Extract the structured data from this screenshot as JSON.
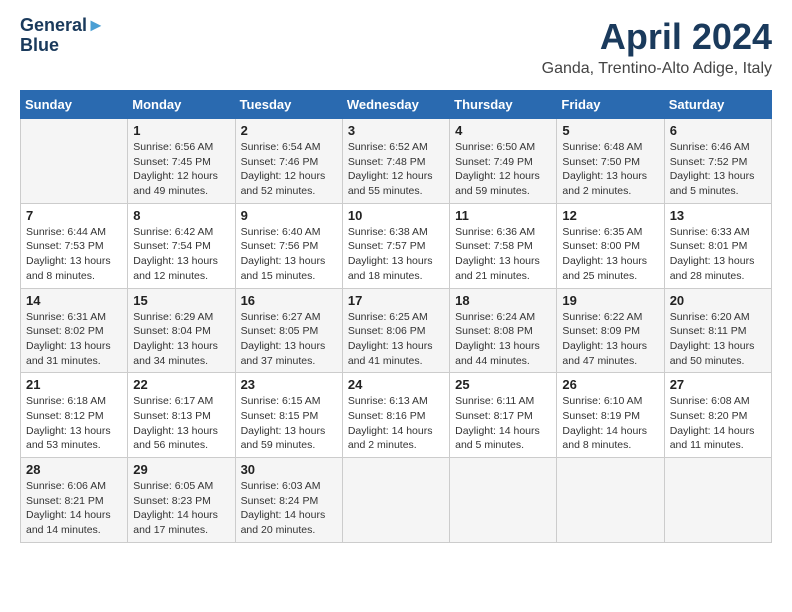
{
  "header": {
    "logo_line1": "General",
    "logo_line2": "Blue",
    "month": "April 2024",
    "location": "Ganda, Trentino-Alto Adige, Italy"
  },
  "weekdays": [
    "Sunday",
    "Monday",
    "Tuesday",
    "Wednesday",
    "Thursday",
    "Friday",
    "Saturday"
  ],
  "weeks": [
    [
      {
        "day": "",
        "info": ""
      },
      {
        "day": "1",
        "info": "Sunrise: 6:56 AM\nSunset: 7:45 PM\nDaylight: 12 hours\nand 49 minutes."
      },
      {
        "day": "2",
        "info": "Sunrise: 6:54 AM\nSunset: 7:46 PM\nDaylight: 12 hours\nand 52 minutes."
      },
      {
        "day": "3",
        "info": "Sunrise: 6:52 AM\nSunset: 7:48 PM\nDaylight: 12 hours\nand 55 minutes."
      },
      {
        "day": "4",
        "info": "Sunrise: 6:50 AM\nSunset: 7:49 PM\nDaylight: 12 hours\nand 59 minutes."
      },
      {
        "day": "5",
        "info": "Sunrise: 6:48 AM\nSunset: 7:50 PM\nDaylight: 13 hours\nand 2 minutes."
      },
      {
        "day": "6",
        "info": "Sunrise: 6:46 AM\nSunset: 7:52 PM\nDaylight: 13 hours\nand 5 minutes."
      }
    ],
    [
      {
        "day": "7",
        "info": "Sunrise: 6:44 AM\nSunset: 7:53 PM\nDaylight: 13 hours\nand 8 minutes."
      },
      {
        "day": "8",
        "info": "Sunrise: 6:42 AM\nSunset: 7:54 PM\nDaylight: 13 hours\nand 12 minutes."
      },
      {
        "day": "9",
        "info": "Sunrise: 6:40 AM\nSunset: 7:56 PM\nDaylight: 13 hours\nand 15 minutes."
      },
      {
        "day": "10",
        "info": "Sunrise: 6:38 AM\nSunset: 7:57 PM\nDaylight: 13 hours\nand 18 minutes."
      },
      {
        "day": "11",
        "info": "Sunrise: 6:36 AM\nSunset: 7:58 PM\nDaylight: 13 hours\nand 21 minutes."
      },
      {
        "day": "12",
        "info": "Sunrise: 6:35 AM\nSunset: 8:00 PM\nDaylight: 13 hours\nand 25 minutes."
      },
      {
        "day": "13",
        "info": "Sunrise: 6:33 AM\nSunset: 8:01 PM\nDaylight: 13 hours\nand 28 minutes."
      }
    ],
    [
      {
        "day": "14",
        "info": "Sunrise: 6:31 AM\nSunset: 8:02 PM\nDaylight: 13 hours\nand 31 minutes."
      },
      {
        "day": "15",
        "info": "Sunrise: 6:29 AM\nSunset: 8:04 PM\nDaylight: 13 hours\nand 34 minutes."
      },
      {
        "day": "16",
        "info": "Sunrise: 6:27 AM\nSunset: 8:05 PM\nDaylight: 13 hours\nand 37 minutes."
      },
      {
        "day": "17",
        "info": "Sunrise: 6:25 AM\nSunset: 8:06 PM\nDaylight: 13 hours\nand 41 minutes."
      },
      {
        "day": "18",
        "info": "Sunrise: 6:24 AM\nSunset: 8:08 PM\nDaylight: 13 hours\nand 44 minutes."
      },
      {
        "day": "19",
        "info": "Sunrise: 6:22 AM\nSunset: 8:09 PM\nDaylight: 13 hours\nand 47 minutes."
      },
      {
        "day": "20",
        "info": "Sunrise: 6:20 AM\nSunset: 8:11 PM\nDaylight: 13 hours\nand 50 minutes."
      }
    ],
    [
      {
        "day": "21",
        "info": "Sunrise: 6:18 AM\nSunset: 8:12 PM\nDaylight: 13 hours\nand 53 minutes."
      },
      {
        "day": "22",
        "info": "Sunrise: 6:17 AM\nSunset: 8:13 PM\nDaylight: 13 hours\nand 56 minutes."
      },
      {
        "day": "23",
        "info": "Sunrise: 6:15 AM\nSunset: 8:15 PM\nDaylight: 13 hours\nand 59 minutes."
      },
      {
        "day": "24",
        "info": "Sunrise: 6:13 AM\nSunset: 8:16 PM\nDaylight: 14 hours\nand 2 minutes."
      },
      {
        "day": "25",
        "info": "Sunrise: 6:11 AM\nSunset: 8:17 PM\nDaylight: 14 hours\nand 5 minutes."
      },
      {
        "day": "26",
        "info": "Sunrise: 6:10 AM\nSunset: 8:19 PM\nDaylight: 14 hours\nand 8 minutes."
      },
      {
        "day": "27",
        "info": "Sunrise: 6:08 AM\nSunset: 8:20 PM\nDaylight: 14 hours\nand 11 minutes."
      }
    ],
    [
      {
        "day": "28",
        "info": "Sunrise: 6:06 AM\nSunset: 8:21 PM\nDaylight: 14 hours\nand 14 minutes."
      },
      {
        "day": "29",
        "info": "Sunrise: 6:05 AM\nSunset: 8:23 PM\nDaylight: 14 hours\nand 17 minutes."
      },
      {
        "day": "30",
        "info": "Sunrise: 6:03 AM\nSunset: 8:24 PM\nDaylight: 14 hours\nand 20 minutes."
      },
      {
        "day": "",
        "info": ""
      },
      {
        "day": "",
        "info": ""
      },
      {
        "day": "",
        "info": ""
      },
      {
        "day": "",
        "info": ""
      }
    ]
  ]
}
